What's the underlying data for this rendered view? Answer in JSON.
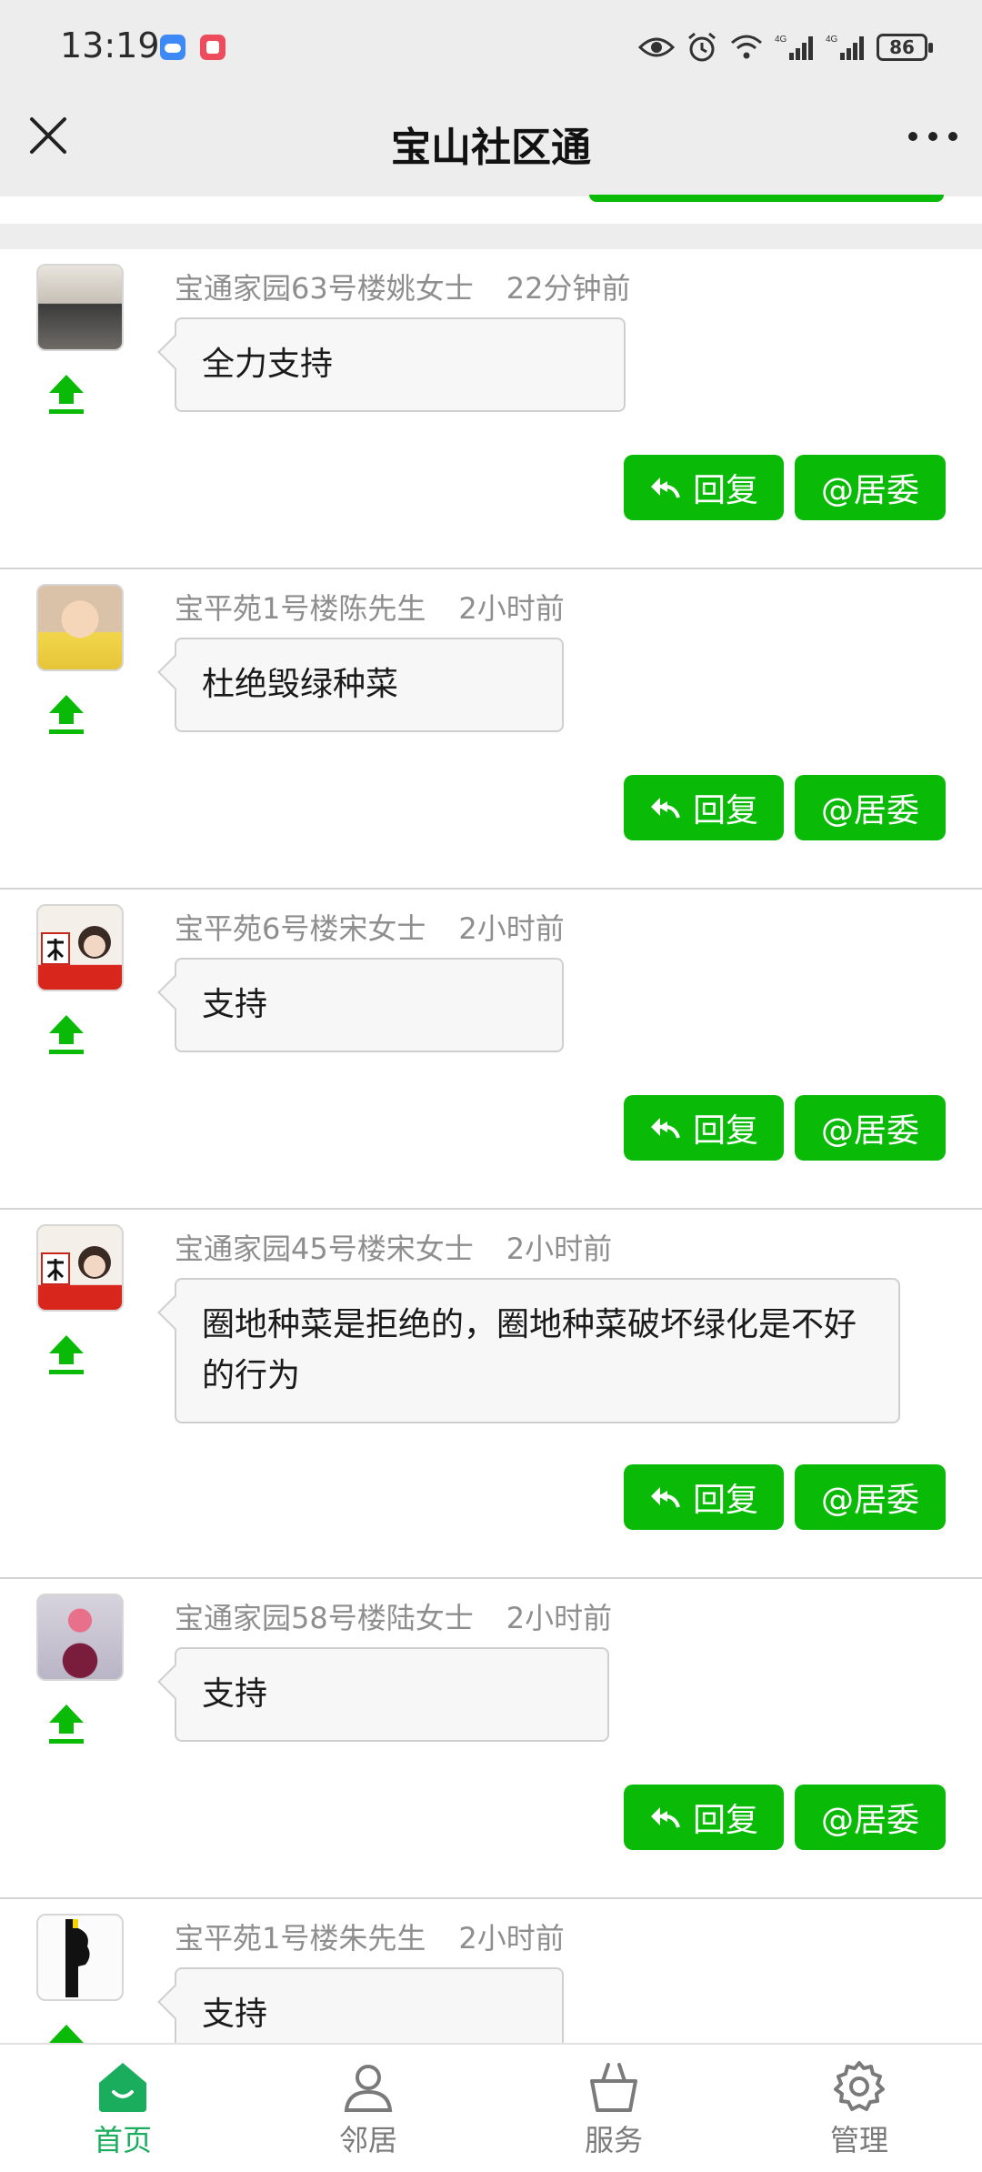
{
  "status_bar": {
    "time": "13:19",
    "battery": "86"
  },
  "header": {
    "title": "宝山社区通"
  },
  "comments": [
    {
      "author": "宝通家园63号楼姚女士",
      "time": "22分钟前",
      "text": "全力支持"
    },
    {
      "author": "宝平苑1号楼陈先生",
      "time": "2小时前",
      "text": "杜绝毁绿种菜"
    },
    {
      "author": "宝平苑6号楼宋女士",
      "time": "2小时前",
      "text": "支持"
    },
    {
      "author": "宝通家园45号楼宋女士",
      "time": "2小时前",
      "text": "圈地种菜是拒绝的，圈地种菜破坏绿化是不好的行为"
    },
    {
      "author": "宝通家园58号楼陆女士",
      "time": "2小时前",
      "text": "支持"
    },
    {
      "author": "宝平苑1号楼朱先生",
      "time": "2小时前",
      "text": "支持"
    }
  ],
  "actions": {
    "reply": "回复",
    "mention": "@居委"
  },
  "nav": [
    {
      "label": "首页",
      "icon": "home-icon",
      "active": true
    },
    {
      "label": "邻居",
      "icon": "person-icon",
      "active": false
    },
    {
      "label": "服务",
      "icon": "basket-icon",
      "active": false
    },
    {
      "label": "管理",
      "icon": "gear-icon",
      "active": false
    }
  ],
  "colors": {
    "accent": "#09bb07",
    "nav_active": "#1aad5e",
    "header_bg": "#ededed"
  }
}
